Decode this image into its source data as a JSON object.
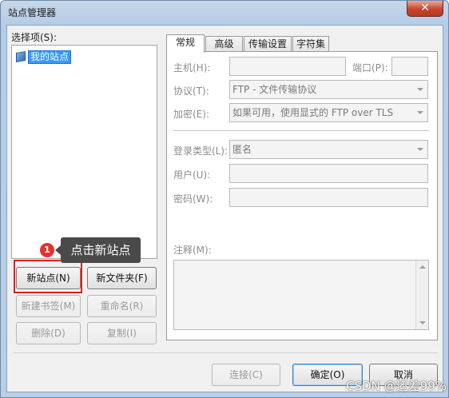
{
  "window": {
    "title": "站点管理器",
    "close_glyph": "✕"
  },
  "left": {
    "label": "选择项(S):",
    "tree": [
      {
        "label": "我的站点",
        "icon": "folder-sites-icon"
      }
    ],
    "buttons": {
      "new_site": "新站点(N)",
      "new_folder": "新文件夹(F)",
      "new_bookmark": "新建书签(M)",
      "rename": "重命名(R)",
      "delete": "删除(D)",
      "copy": "复制(I)"
    }
  },
  "annotation": {
    "badge": "1",
    "tooltip": "点击新站点"
  },
  "tabs": [
    "常规",
    "高级",
    "传输设置",
    "字符集"
  ],
  "general": {
    "host_label": "主机(H):",
    "host_value": "",
    "port_label": "端口(P):",
    "port_value": "",
    "protocol_label": "协议(T):",
    "protocol_value": "FTP - 文件传输协议",
    "encryption_label": "加密(E):",
    "encryption_value": "如果可用，使用显式的 FTP over TLS",
    "logon_label": "登录类型(L):",
    "logon_value": "匿名",
    "user_label": "用户(U):",
    "user_value": "",
    "password_label": "密码(W):",
    "password_value": "",
    "comment_label": "注释(M):",
    "comment_value": ""
  },
  "footer": {
    "connect": "连接(C)",
    "ok": "确定(O)",
    "cancel": "取消"
  },
  "watermark": "CSDN @还差99%",
  "colors": {
    "selection": "#3399ff",
    "highlight_border": "#e02020",
    "badge": "#e5322d"
  }
}
